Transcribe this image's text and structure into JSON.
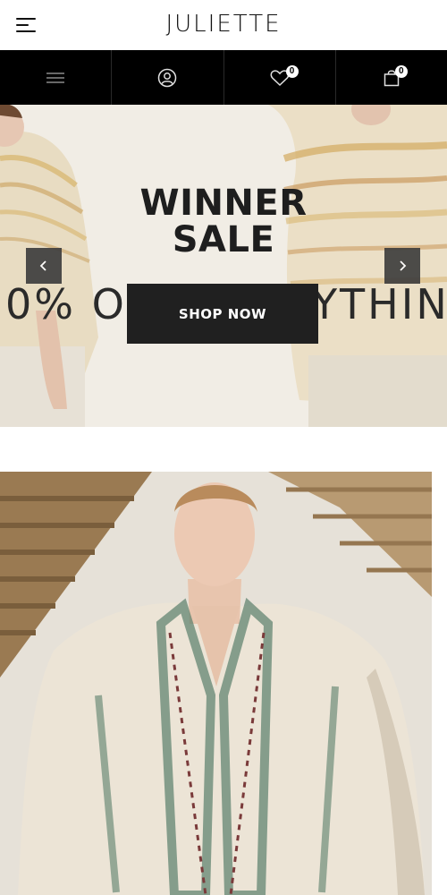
{
  "header": {
    "brand": "JULIETTE",
    "menu_icon": "hamburger-menu-icon"
  },
  "toolbar": {
    "items": [
      {
        "icon": "menu-lines-icon"
      },
      {
        "icon": "user-account-icon"
      },
      {
        "icon": "wishlist-heart-icon",
        "badge": "0"
      },
      {
        "icon": "shopping-bag-icon",
        "badge": "0"
      }
    ]
  },
  "hero": {
    "title_line1": "WINNER",
    "title_line2": "SALE",
    "marquee_text": "0% OFF EVERYTHIN",
    "cta_label": "SHOP NOW",
    "prev_icon": "chevron-left-icon",
    "next_icon": "chevron-right-icon"
  },
  "feature": {
    "image": "model-embroidered-shirt-photo"
  },
  "colors": {
    "toolbar_bg": "#000000",
    "cta_bg": "#202020",
    "hero_bg": "#efebe2",
    "text_dark": "#1e1e1e"
  }
}
